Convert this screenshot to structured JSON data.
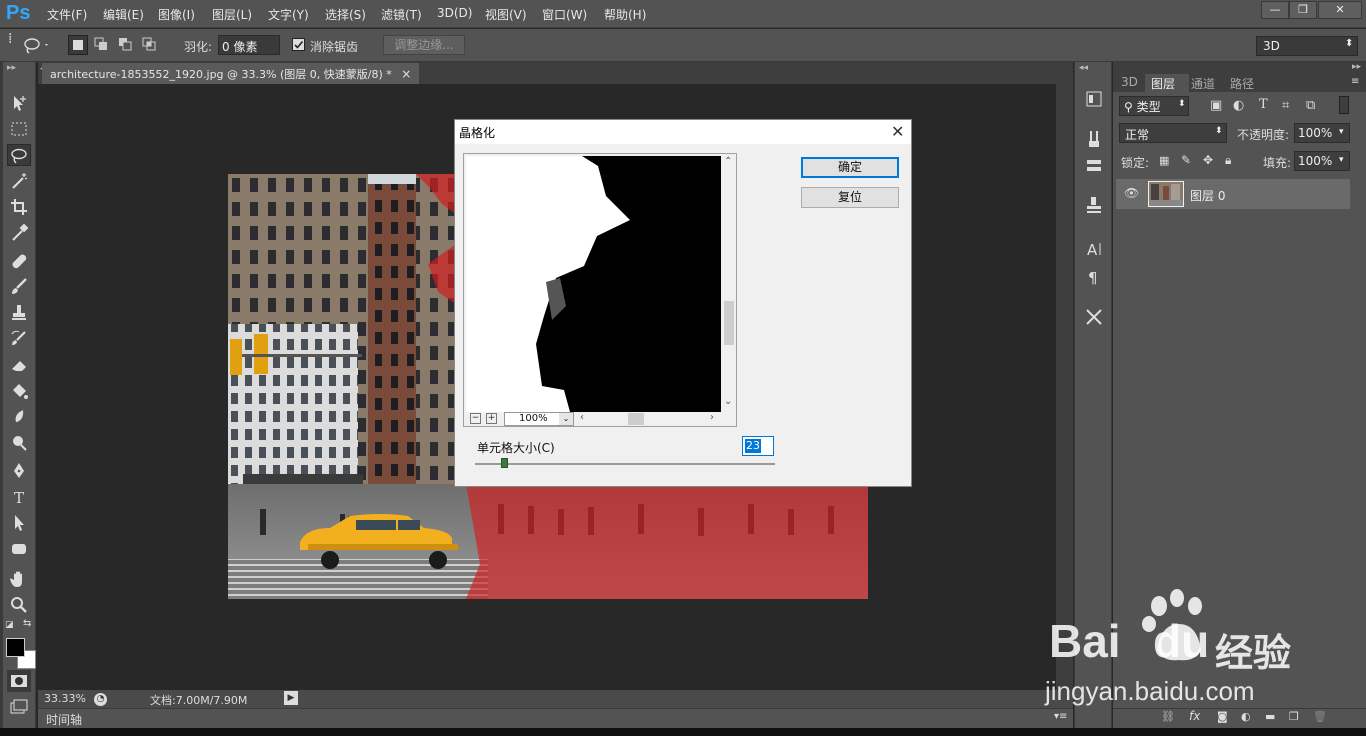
{
  "app": {
    "logo": "Ps"
  },
  "menu": {
    "items": [
      "文件(F)",
      "编辑(E)",
      "图像(I)",
      "图层(L)",
      "文字(Y)",
      "选择(S)",
      "滤镜(T)",
      "3D(D)",
      "视图(V)",
      "窗口(W)",
      "帮助(H)"
    ]
  },
  "window_controls": {
    "minimize": "—",
    "restore": "❐",
    "close": "✕"
  },
  "options": {
    "feather_label": "羽化:",
    "feather_value": "0 像素",
    "antialias_label": "消除锯齿",
    "refine_edge_label": "调整边缘...",
    "workspace": "3D"
  },
  "document": {
    "tab_title": "architecture-1853552_1920.jpg @ 33.3% (图层 0, 快速蒙版/8) *",
    "tab_close": "×"
  },
  "status": {
    "zoom": "33.33%",
    "doc_size": "文档:7.00M/7.90M"
  },
  "timeline": {
    "label": "时间轴"
  },
  "layers_panel": {
    "tabs": [
      "3D",
      "图层",
      "通道",
      "路径"
    ],
    "active_tab_index": 1,
    "filter_kind": "类型",
    "blend_mode": "正常",
    "opacity_label": "不透明度:",
    "opacity_value": "100%",
    "lock_label": "锁定:",
    "fill_label": "填充:",
    "fill_value": "100%",
    "layers": [
      {
        "name": "图层 0",
        "visible": true
      }
    ]
  },
  "dialog": {
    "title": "晶格化",
    "ok_label": "确定",
    "reset_label": "复位",
    "zoom_value": "100%",
    "cell_size_label": "单元格大小(C)",
    "cell_size_value": "23"
  },
  "watermark": {
    "brand": "Bai",
    "brand2": "du",
    "cn": "经验",
    "url": "jingyan.baidu.com"
  },
  "colors": {
    "ps_blue": "#31a8ff",
    "ui_dark": "#535353",
    "canvas_bg": "#282828",
    "dialog_bg": "#f0f0f0",
    "quick_mask_red": "#d22020",
    "accent_blue": "#0078d7"
  }
}
